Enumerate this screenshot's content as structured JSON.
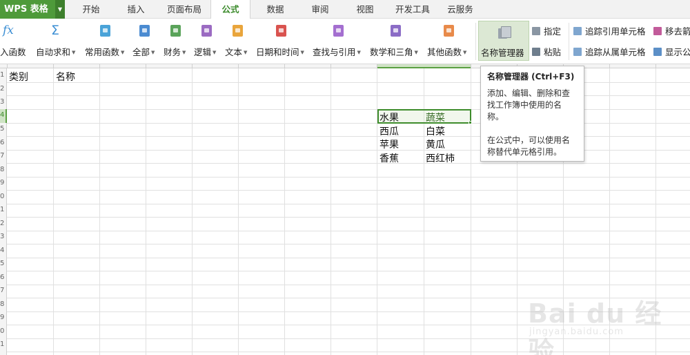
{
  "app": {
    "title": "WPS 表格"
  },
  "tabs": [
    {
      "label": "开始",
      "active": false
    },
    {
      "label": "插入",
      "active": false
    },
    {
      "label": "页面布局",
      "active": false
    },
    {
      "label": "公式",
      "active": true
    },
    {
      "label": "数据",
      "active": false
    },
    {
      "label": "审阅",
      "active": false
    },
    {
      "label": "视图",
      "active": false
    },
    {
      "label": "开发工具",
      "active": false
    },
    {
      "label": "云服务",
      "active": false
    }
  ],
  "ribbon": {
    "insert_function": {
      "icon": "fx-icon",
      "label": "入函数"
    },
    "autosum": {
      "icon": "sigma-icon",
      "label": "自动求和"
    },
    "function_buttons": [
      {
        "label": "常用函数",
        "icon": "common-function-icon",
        "color": "#4aa3d8"
      },
      {
        "label": "全部",
        "icon": "all-functions-icon",
        "color": "#4b8bd1"
      },
      {
        "label": "财务",
        "icon": "finance-icon",
        "color": "#5aa35a"
      },
      {
        "label": "逻辑",
        "icon": "logic-icon",
        "color": "#9b6bc2"
      },
      {
        "label": "文本",
        "icon": "text-function-icon",
        "color": "#e9a53c"
      },
      {
        "label": "日期和时间",
        "icon": "date-time-icon",
        "color": "#d9534f"
      },
      {
        "label": "查找与引用",
        "icon": "lookup-reference-icon",
        "color": "#a46fd0"
      },
      {
        "label": "数学和三角",
        "icon": "math-trig-icon",
        "color": "#8b6cc6"
      },
      {
        "label": "其他函数",
        "icon": "other-functions-icon",
        "color": "#e88a4a"
      }
    ],
    "name_manager": {
      "label": "名称管理器",
      "icon": "name-manager-icon"
    },
    "define": {
      "label": "指定",
      "icon": "define-name-icon"
    },
    "paste": {
      "label": "粘贴",
      "icon": "paste-name-icon"
    },
    "trace_precedents": {
      "label": "追踪引用单元格",
      "icon": "trace-precedents-icon"
    },
    "trace_dependents": {
      "label": "追踪从属单元格",
      "icon": "trace-dependents-icon"
    },
    "remove_arrows": {
      "label": "移去箭",
      "icon": "remove-arrows-icon"
    },
    "show_formulas": {
      "label": "显示公",
      "icon": "show-formulas-icon"
    }
  },
  "tooltip": {
    "title": "名称管理器 (Ctrl+F3)",
    "desc1": "添加、编辑、删除和查找工作簿中使用的名称。",
    "desc2": "在公式中，可以使用名称替代单元格引用。"
  },
  "sheet": {
    "headers": [
      "类别",
      "名称"
    ],
    "table": [
      [
        "水果",
        "蔬菜"
      ],
      [
        "西瓜",
        "白菜"
      ],
      [
        "苹果",
        "黄瓜"
      ],
      [
        "香蕉",
        "西红柿"
      ]
    ],
    "row_numbers": [
      "1",
      "2",
      "3",
      "4",
      "5",
      "6",
      "7",
      "8",
      "9",
      "0",
      "1",
      "2",
      "3",
      "4",
      "5",
      "6",
      "7",
      "8",
      "9",
      "0",
      "1"
    ]
  },
  "watermark": {
    "text": "Bai du 经验",
    "sub": "jingyan.baidu.com"
  },
  "colors": {
    "accent_green": "#3e8c2c",
    "app_button": "#4e9a3a",
    "selection_fill": "#dce8d4"
  }
}
